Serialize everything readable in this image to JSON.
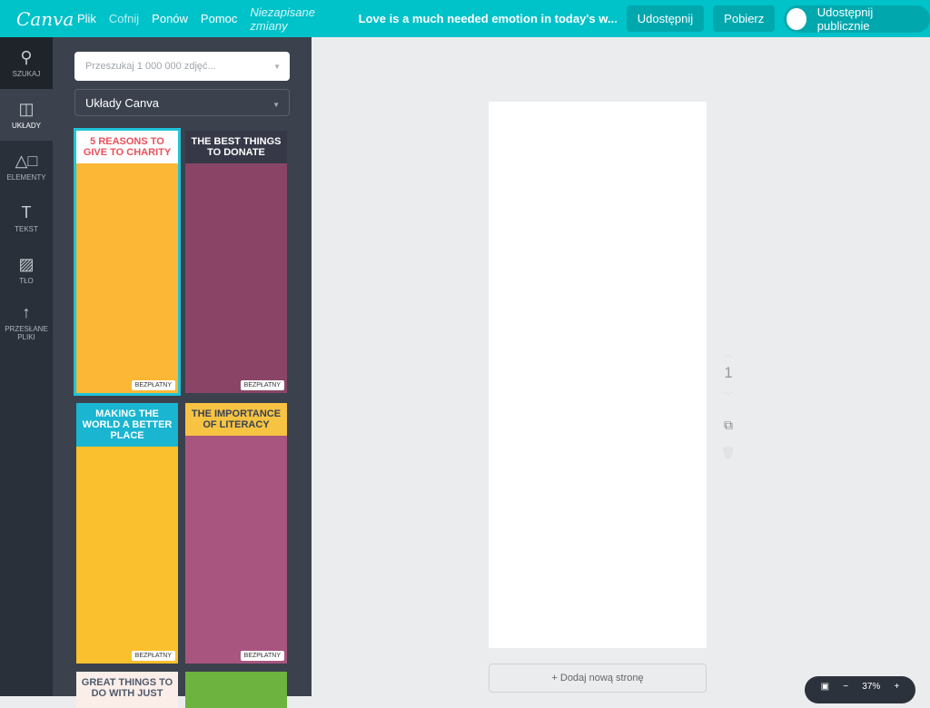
{
  "topbar": {
    "logo": "Canva",
    "menu": [
      "Plik",
      "Cofnij",
      "Ponów",
      "Pomoc"
    ],
    "status": "Niezapisane zmiany",
    "doc_title": "Love is a much needed emotion in today's w...",
    "share": "Udostępnij",
    "download": "Pobierz",
    "public_share": "Udostępnij publicznie"
  },
  "rail": [
    {
      "label": "SZUKAJ",
      "icon": "search-icon",
      "glyph": "⚲"
    },
    {
      "label": "UKŁADY",
      "icon": "layout-icon",
      "glyph": "◫"
    },
    {
      "label": "ELEMENTY",
      "icon": "shapes-icon",
      "glyph": "△□"
    },
    {
      "label": "TEKST",
      "icon": "text-icon",
      "glyph": "T"
    },
    {
      "label": "TŁO",
      "icon": "background-icon",
      "glyph": "▨"
    },
    {
      "label": "PRZESŁANE PLIKI",
      "icon": "upload-icon",
      "glyph": "↑"
    }
  ],
  "panel": {
    "search_placeholder": "Przeszukaj 1 000 000 zdjęć...",
    "layout_select": "Układy Canva",
    "templates": [
      {
        "title": "5 REASONS TO GIVE TO CHARITY",
        "badge": "BEZPŁATNY",
        "bg": "#fbb735",
        "head": "#ffffff",
        "fg": "#e8505b"
      },
      {
        "title": "THE BEST THINGS TO DONATE",
        "badge": "BEZPŁATNY",
        "bg": "#8a4566",
        "head": "#363848",
        "fg": "#ffffff"
      },
      {
        "title": "MAKING THE WORLD A BETTER PLACE",
        "badge": "BEZPŁATNY",
        "bg": "#fbc02d",
        "head": "#1ab5d0",
        "fg": "#ffffff"
      },
      {
        "title": "THE IMPORTANCE OF LITERACY",
        "badge": "BEZPŁATNY",
        "bg": "#a8557f",
        "head": "#f6c343",
        "fg": "#3a4252"
      },
      {
        "title": "GREAT THINGS TO DO WITH JUST",
        "badge": "",
        "bg": "#fbeee8",
        "head": "#fbeee8",
        "fg": "#4f5b6e"
      },
      {
        "title": "",
        "badge": "",
        "bg": "#6db33f",
        "head": "#6db33f",
        "fg": "#fff"
      }
    ]
  },
  "canvas": {
    "page_number": "1",
    "add_page": "+ Dodaj nową stronę",
    "zoom": "37%"
  }
}
